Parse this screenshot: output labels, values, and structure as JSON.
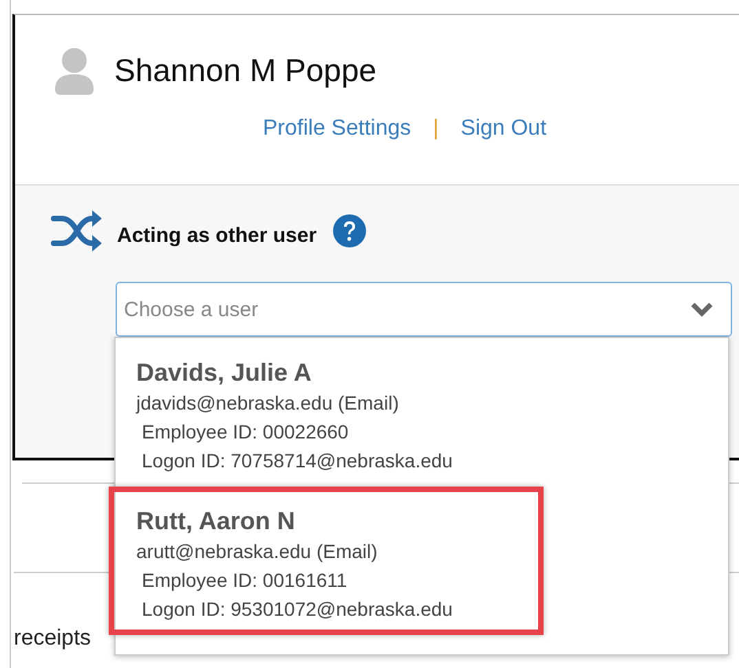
{
  "background": {
    "label": "receipts"
  },
  "profile": {
    "name": "Shannon M Poppe",
    "links": [
      {
        "label": "Profile Settings"
      },
      {
        "label": "Sign Out"
      }
    ],
    "separator": "|"
  },
  "acting": {
    "label": "Acting as other user",
    "search": {
      "placeholder": "Choose a user"
    }
  },
  "users": [
    {
      "name": "Davids, Julie A",
      "email": "jdavids@nebraska.edu (Email)",
      "employee_id": "Employee ID: 00022660",
      "logon_id": "Logon ID: 70758714@nebraska.edu",
      "highlighted": false
    },
    {
      "name": "Rutt, Aaron N",
      "email": "arutt@nebraska.edu (Email)",
      "employee_id": "Employee ID: 00161611",
      "logon_id": "Logon ID: 95301072@nebraska.edu",
      "highlighted": true
    }
  ]
}
